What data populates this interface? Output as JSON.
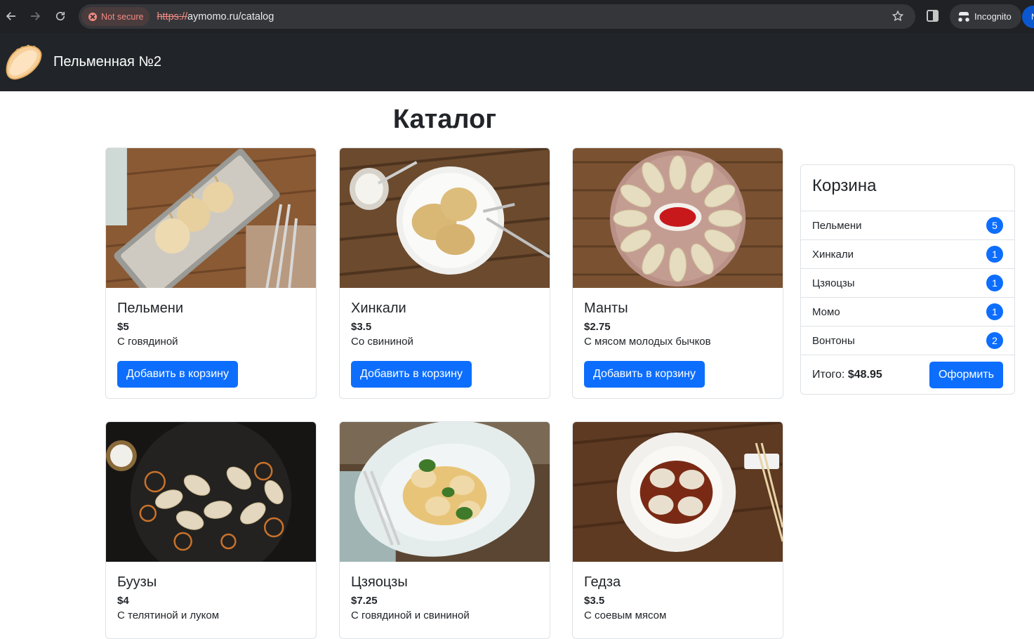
{
  "browser": {
    "security_label": "Not secure",
    "url_scheme": "https://",
    "url_rest": "aymomo.ru/catalog",
    "incognito_label": "Incognito",
    "profile_initial": "N"
  },
  "navbar": {
    "brand": "Пельменная №2"
  },
  "page": {
    "title": "Каталог"
  },
  "add_button_label": "Добавить в корзину",
  "products": [
    {
      "name": "Пельмени",
      "price": "$5",
      "description": "С говядиной"
    },
    {
      "name": "Хинкали",
      "price": "$3.5",
      "description": "Со свининой"
    },
    {
      "name": "Манты",
      "price": "$2.75",
      "description": "С мясом молодых бычков"
    },
    {
      "name": "Буузы",
      "price": "$4",
      "description": "С телятиной и луком"
    },
    {
      "name": "Цзяоцзы",
      "price": "$7.25",
      "description": "С говядиной и свининой"
    },
    {
      "name": "Гедза",
      "price": "$3.5",
      "description": "С соевым мясом"
    }
  ],
  "cart": {
    "title": "Корзина",
    "items": [
      {
        "name": "Пельмени",
        "qty": "5"
      },
      {
        "name": "Хинкали",
        "qty": "1"
      },
      {
        "name": "Цзяоцзы",
        "qty": "1"
      },
      {
        "name": "Момо",
        "qty": "1"
      },
      {
        "name": "Вонтоны",
        "qty": "2"
      }
    ],
    "total_label": "Итого:",
    "total_value": "$48.95",
    "checkout_label": "Оформить"
  },
  "colors": {
    "primary": "#0d6efd",
    "navbar_bg": "#212529",
    "chrome_bg": "#202124"
  }
}
